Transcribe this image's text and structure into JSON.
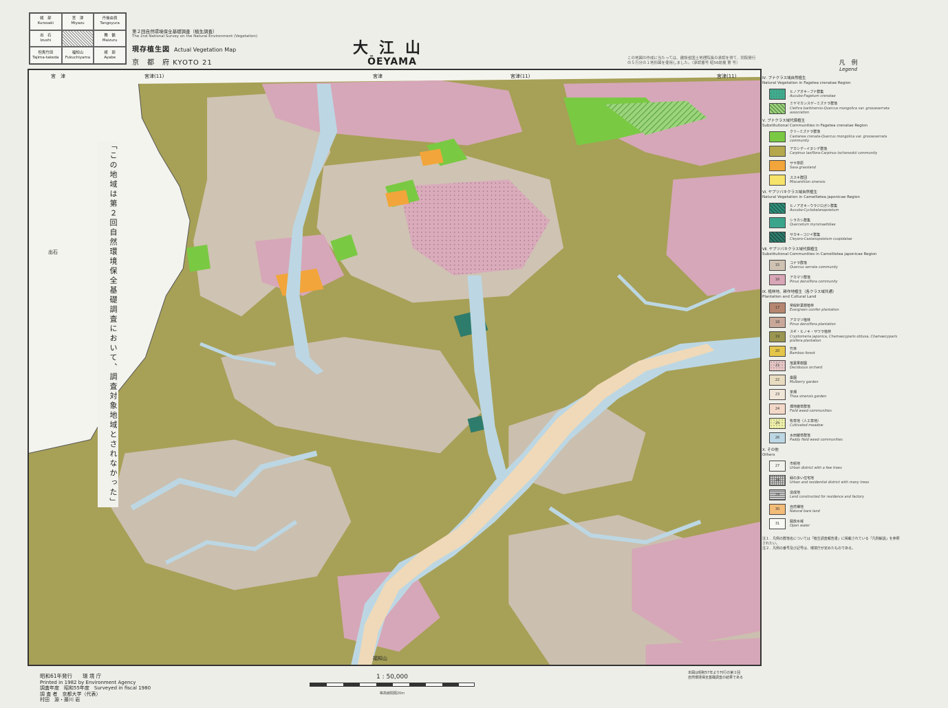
{
  "index_map": {
    "cells": [
      {
        "jp": "綾　部",
        "en": "Kurosaki"
      },
      {
        "jp": "宮　津",
        "en": "Miyazu"
      },
      {
        "jp": "丹後由良",
        "en": "Tangoyura"
      },
      {
        "jp": "出　石",
        "en": "Izushi"
      },
      {
        "jp": "",
        "en": ""
      },
      {
        "jp": "舞　鶴",
        "en": "Maizuru"
      },
      {
        "jp": "但馬竹田",
        "en": "Tajima-takeda"
      },
      {
        "jp": "福知山",
        "en": "Fukuchiyama"
      },
      {
        "jp": "綾　部",
        "en": "Ayabe"
      }
    ]
  },
  "survey": {
    "jp": "第２回自然環境保全基礎調査（植生調査）",
    "en": "The 2nd National Survey on the Natural Environment (Vegetation)",
    "map_kind_jp": "現存植生図",
    "map_kind_en": "Actual Vegetation Map",
    "prefecture": "京　都　府 KYOTO 21"
  },
  "title": {
    "jp": "大江山",
    "en": "ŌEYAMA"
  },
  "top_note": "この地図の作成に当たっては、建設省国土地理院長の承認を得て、同院発行の５万分の１地形図を使用しました。（承認番号 昭56総複 第 号）",
  "edge_labels": {
    "top": [
      "宮　津",
      "宮津(11)",
      "宮津(11)",
      "宮津(11)",
      "宮津(11)",
      "宮津"
    ],
    "bottom": [
      "福知山",
      "福知山"
    ],
    "left": [
      "出石",
      "出石"
    ]
  },
  "margin_note": "「この地域は第２回自然環境保全基礎調査において、調査対象地域とされなかった」",
  "legend": {
    "heading_jp": "凡　例",
    "heading_en": "Legend",
    "sections": [
      {
        "jp": "Ⅳ. ブナクラス域自然植生",
        "en": "Natural Vegetation in Fagetea crenatae Region",
        "items": [
          {
            "code": "",
            "jp": "ヒノアオキ−ブナ群集",
            "en": "Aucubo-Fagetum crenatae",
            "color": "#3fae8f",
            "pattern": "dots"
          },
          {
            "code": "",
            "jp": "ミヤマカンスゲ−ミズナラ群落",
            "en": "Clethra barbinervis-Quercus mongolica var. grosseserrata association",
            "color": "#9bd47a",
            "pattern": "hatch"
          }
        ]
      },
      {
        "jp": "Ⅴ. ブナクラス域代償植生",
        "en": "Substitutional Communities in Fagetea crenatae Region",
        "items": [
          {
            "code": "",
            "jp": "クリ−ミズナラ群落",
            "en": "Castanea crenata-Quercus mongolica var. grosseserrata community",
            "color": "#7ac943",
            "pattern": "none"
          },
          {
            "code": "",
            "jp": "アカシデ−イヌシデ群落",
            "en": "Carpinus laxiflora-Carpinus tschonoskii community",
            "color": "#b5a84c",
            "pattern": "none"
          },
          {
            "code": "",
            "jp": "ササ草原",
            "en": "Sasa grassland",
            "color": "#f2a53a",
            "pattern": "none"
          },
          {
            "code": "",
            "jp": "ススキ群団",
            "en": "Miscanthion sinensis",
            "color": "#f5e36a",
            "pattern": "none"
          }
        ]
      },
      {
        "jp": "Ⅵ. ヤブツバキクラス域自然植生",
        "en": "Natural Vegetation in Camellietea japonicae Region",
        "items": [
          {
            "code": "",
            "jp": "ヒノアオキ−ウラジロガシ群集",
            "en": "Aucubo-Cyclobalanopsietum",
            "color": "#2f8f7a",
            "pattern": "hatch"
          },
          {
            "code": "",
            "jp": "シラカシ群集",
            "en": "Quercetum myrsinaefoliae",
            "color": "#3ba58c",
            "pattern": "none"
          },
          {
            "code": "",
            "jp": "サカキ−コジイ群集",
            "en": "Cleyero-Castanopsietum cuspidatae",
            "color": "#2e7c6c",
            "pattern": "hatch"
          }
        ]
      },
      {
        "jp": "Ⅶ. ヤブツバキクラス域代償植生",
        "en": "Substitutional Communities in Camellietea japonicae Region",
        "items": [
          {
            "code": "15",
            "jp": "コナラ群落",
            "en": "Quercus serrata community",
            "color": "#cfc2b3",
            "pattern": "none"
          },
          {
            "code": "16",
            "jp": "アカマツ群落",
            "en": "Pinus densiflora community",
            "color": "#d8a6b6",
            "pattern": "none"
          }
        ]
      },
      {
        "jp": "Ⅸ. 植林地、耕作地植生（各クラス域共通）",
        "en": "Plantation and Cultural Land",
        "items": [
          {
            "code": "17",
            "jp": "常緑針葉樹植林",
            "en": "Evergreen conifer plantation",
            "color": "#b68670",
            "pattern": "none"
          },
          {
            "code": "18",
            "jp": "アカマツ植林",
            "en": "Pinus densiflora plantation",
            "color": "#c9a89a",
            "pattern": "none"
          },
          {
            "code": "19",
            "jp": "スギ・ヒノキ・サワラ植林",
            "en": "Cryptomeria japonica, Chamaecyparis obtusa, Chamaecyparis pisifera plantation",
            "color": "#9a9650",
            "pattern": "none"
          },
          {
            "code": "20",
            "jp": "竹林",
            "en": "Bamboo forest",
            "color": "#e4c64a",
            "pattern": "none"
          },
          {
            "code": "21",
            "jp": "落葉果樹園",
            "en": "Deciduous orchard",
            "color": "#e9c7c7",
            "pattern": "dots"
          },
          {
            "code": "22",
            "jp": "桑園",
            "en": "Mulberry garden",
            "color": "#e8dcc0",
            "pattern": "none"
          },
          {
            "code": "23",
            "jp": "茶畑",
            "en": "Thea sinensis garden",
            "color": "#f0e6d8",
            "pattern": "none"
          },
          {
            "code": "24",
            "jp": "畑地雑草群落",
            "en": "Field weed communities",
            "color": "#f3d8c8",
            "pattern": "none"
          },
          {
            "code": "25",
            "jp": "牧草地（人工草地）",
            "en": "Cultivated meadow",
            "color": "#eef0a8",
            "pattern": "dots"
          },
          {
            "code": "26",
            "jp": "水田雑草群落",
            "en": "Paddy field weed communities",
            "color": "#bcd7e3",
            "pattern": "none"
          }
        ]
      },
      {
        "jp": "Ⅹ. その他",
        "en": "Others",
        "items": [
          {
            "code": "27",
            "jp": "市街地",
            "en": "Urban district with a few trees",
            "color": "#f2f2ec",
            "pattern": "none"
          },
          {
            "code": "28",
            "jp": "緑の多い住宅地",
            "en": "Urban and residential district with many trees",
            "color": "#d9d9d4",
            "pattern": "grid"
          },
          {
            "code": "29",
            "jp": "造成地",
            "en": "Land constructed for residence and factory",
            "color": "#cfcfcf",
            "pattern": "lines"
          },
          {
            "code": "30",
            "jp": "自然裸地",
            "en": "Natural bare land",
            "color": "#f2bc78",
            "pattern": "none"
          },
          {
            "code": "31",
            "jp": "開放水域",
            "en": "Open water",
            "color": "#f8f8f4",
            "pattern": "none"
          }
        ]
      }
    ],
    "notes": [
      "注１．凡例の群落名については「植生調査報告書」に掲載されている「凡例解説」を参照されたい。",
      "注２．凡例の番号及び記号は、環境庁が定めたものである。"
    ]
  },
  "footer": {
    "issued_jp": "昭和61年発行　　環 境 庁",
    "printed_en": "Printed in 1982 by Environment Agency",
    "surveyed": "調査年度　昭和55年度　Surveyed in fiscal 1980",
    "surveyor": "調 査 者　京都大学（代表）",
    "surveyor2": "村田　源・藤川 岩"
  },
  "scale": {
    "label": "1 : 50,000",
    "sub": "等高線間隔20m"
  },
  "footer_right": [
    "本図は昭和57年より刊行の第２回",
    "自然環境保全基礎調査の結果である"
  ]
}
